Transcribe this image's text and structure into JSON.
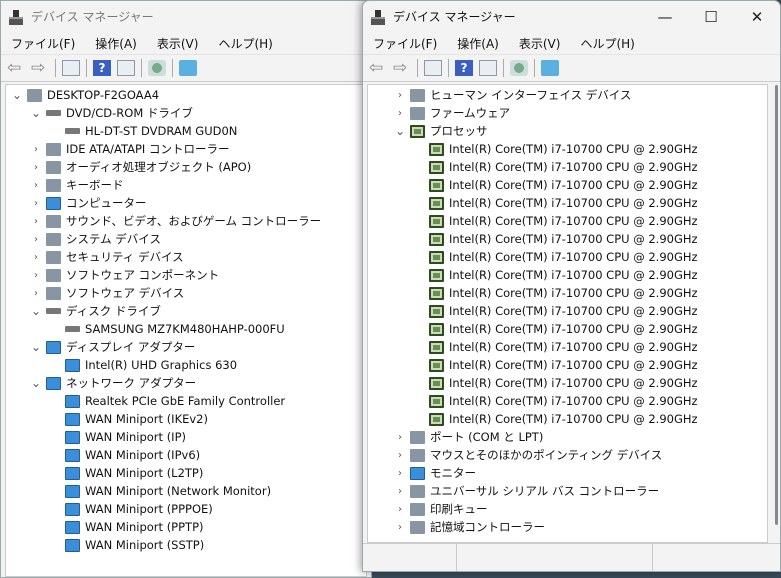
{
  "title": "デバイス マネージャー",
  "menu": [
    "ファイル(F)",
    "操作(A)",
    "表示(V)",
    "ヘルプ(H)"
  ],
  "caption": {
    "minimize": "—",
    "maximize": "☐",
    "close": "✕"
  },
  "left_tree": [
    {
      "l": 0,
      "s": "open",
      "t": "DESKTOP-F2GOAA4"
    },
    {
      "l": 1,
      "s": "open",
      "t": "DVD/CD-ROM ドライブ"
    },
    {
      "l": 2,
      "s": "",
      "t": "HL-DT-ST DVDRAM GUD0N"
    },
    {
      "l": 1,
      "s": "closed",
      "t": "IDE ATA/ATAPI コントローラー"
    },
    {
      "l": 1,
      "s": "closed",
      "t": "オーディオ処理オブジェクト (APO)"
    },
    {
      "l": 1,
      "s": "closed",
      "t": "キーボード"
    },
    {
      "l": 1,
      "s": "closed",
      "t": "コンピューター"
    },
    {
      "l": 1,
      "s": "closed",
      "t": "サウンド、ビデオ、およびゲーム コントローラー"
    },
    {
      "l": 1,
      "s": "closed",
      "t": "システム デバイス"
    },
    {
      "l": 1,
      "s": "closed",
      "t": "セキュリティ デバイス"
    },
    {
      "l": 1,
      "s": "closed",
      "t": "ソフトウェア コンポーネント"
    },
    {
      "l": 1,
      "s": "closed",
      "t": "ソフトウェア デバイス"
    },
    {
      "l": 1,
      "s": "open",
      "t": "ディスク ドライブ"
    },
    {
      "l": 2,
      "s": "",
      "t": "SAMSUNG MZ7KM480HAHP-000FU"
    },
    {
      "l": 1,
      "s": "open",
      "t": "ディスプレイ アダプター"
    },
    {
      "l": 2,
      "s": "",
      "t": "Intel(R) UHD Graphics 630"
    },
    {
      "l": 1,
      "s": "open",
      "t": "ネットワーク アダプター"
    },
    {
      "l": 2,
      "s": "",
      "t": "Realtek PCIe GbE Family Controller"
    },
    {
      "l": 2,
      "s": "",
      "t": "WAN Miniport (IKEv2)"
    },
    {
      "l": 2,
      "s": "",
      "t": "WAN Miniport (IP)"
    },
    {
      "l": 2,
      "s": "",
      "t": "WAN Miniport (IPv6)"
    },
    {
      "l": 2,
      "s": "",
      "t": "WAN Miniport (L2TP)"
    },
    {
      "l": 2,
      "s": "",
      "t": "WAN Miniport (Network Monitor)"
    },
    {
      "l": 2,
      "s": "",
      "t": "WAN Miniport (PPPOE)"
    },
    {
      "l": 2,
      "s": "",
      "t": "WAN Miniport (PPTP)"
    },
    {
      "l": 2,
      "s": "",
      "t": "WAN Miniport (SSTP)"
    }
  ],
  "right_tree": [
    {
      "l": 1,
      "s": "closed",
      "t": "ヒューマン インターフェイス デバイス"
    },
    {
      "l": 1,
      "s": "closed",
      "t": "ファームウェア"
    },
    {
      "l": 1,
      "s": "open",
      "t": "プロセッサ",
      "i": "cpu"
    },
    {
      "l": 2,
      "s": "",
      "t": "Intel(R) Core(TM) i7-10700 CPU @ 2.90GHz",
      "i": "cpu"
    },
    {
      "l": 2,
      "s": "",
      "t": "Intel(R) Core(TM) i7-10700 CPU @ 2.90GHz",
      "i": "cpu"
    },
    {
      "l": 2,
      "s": "",
      "t": "Intel(R) Core(TM) i7-10700 CPU @ 2.90GHz",
      "i": "cpu"
    },
    {
      "l": 2,
      "s": "",
      "t": "Intel(R) Core(TM) i7-10700 CPU @ 2.90GHz",
      "i": "cpu"
    },
    {
      "l": 2,
      "s": "",
      "t": "Intel(R) Core(TM) i7-10700 CPU @ 2.90GHz",
      "i": "cpu"
    },
    {
      "l": 2,
      "s": "",
      "t": "Intel(R) Core(TM) i7-10700 CPU @ 2.90GHz",
      "i": "cpu"
    },
    {
      "l": 2,
      "s": "",
      "t": "Intel(R) Core(TM) i7-10700 CPU @ 2.90GHz",
      "i": "cpu"
    },
    {
      "l": 2,
      "s": "",
      "t": "Intel(R) Core(TM) i7-10700 CPU @ 2.90GHz",
      "i": "cpu"
    },
    {
      "l": 2,
      "s": "",
      "t": "Intel(R) Core(TM) i7-10700 CPU @ 2.90GHz",
      "i": "cpu"
    },
    {
      "l": 2,
      "s": "",
      "t": "Intel(R) Core(TM) i7-10700 CPU @ 2.90GHz",
      "i": "cpu"
    },
    {
      "l": 2,
      "s": "",
      "t": "Intel(R) Core(TM) i7-10700 CPU @ 2.90GHz",
      "i": "cpu"
    },
    {
      "l": 2,
      "s": "",
      "t": "Intel(R) Core(TM) i7-10700 CPU @ 2.90GHz",
      "i": "cpu"
    },
    {
      "l": 2,
      "s": "",
      "t": "Intel(R) Core(TM) i7-10700 CPU @ 2.90GHz",
      "i": "cpu"
    },
    {
      "l": 2,
      "s": "",
      "t": "Intel(R) Core(TM) i7-10700 CPU @ 2.90GHz",
      "i": "cpu"
    },
    {
      "l": 2,
      "s": "",
      "t": "Intel(R) Core(TM) i7-10700 CPU @ 2.90GHz",
      "i": "cpu"
    },
    {
      "l": 2,
      "s": "",
      "t": "Intel(R) Core(TM) i7-10700 CPU @ 2.90GHz",
      "i": "cpu"
    },
    {
      "l": 1,
      "s": "closed",
      "t": "ポート (COM と LPT)"
    },
    {
      "l": 1,
      "s": "closed",
      "t": "マウスとそのほかのポインティング デバイス"
    },
    {
      "l": 1,
      "s": "closed",
      "t": "モニター",
      "i": "net"
    },
    {
      "l": 1,
      "s": "closed",
      "t": "ユニバーサル シリアル バス コントローラー"
    },
    {
      "l": 1,
      "s": "closed",
      "t": "印刷キュー"
    },
    {
      "l": 1,
      "s": "closed",
      "t": "記憶域コントローラー"
    }
  ]
}
